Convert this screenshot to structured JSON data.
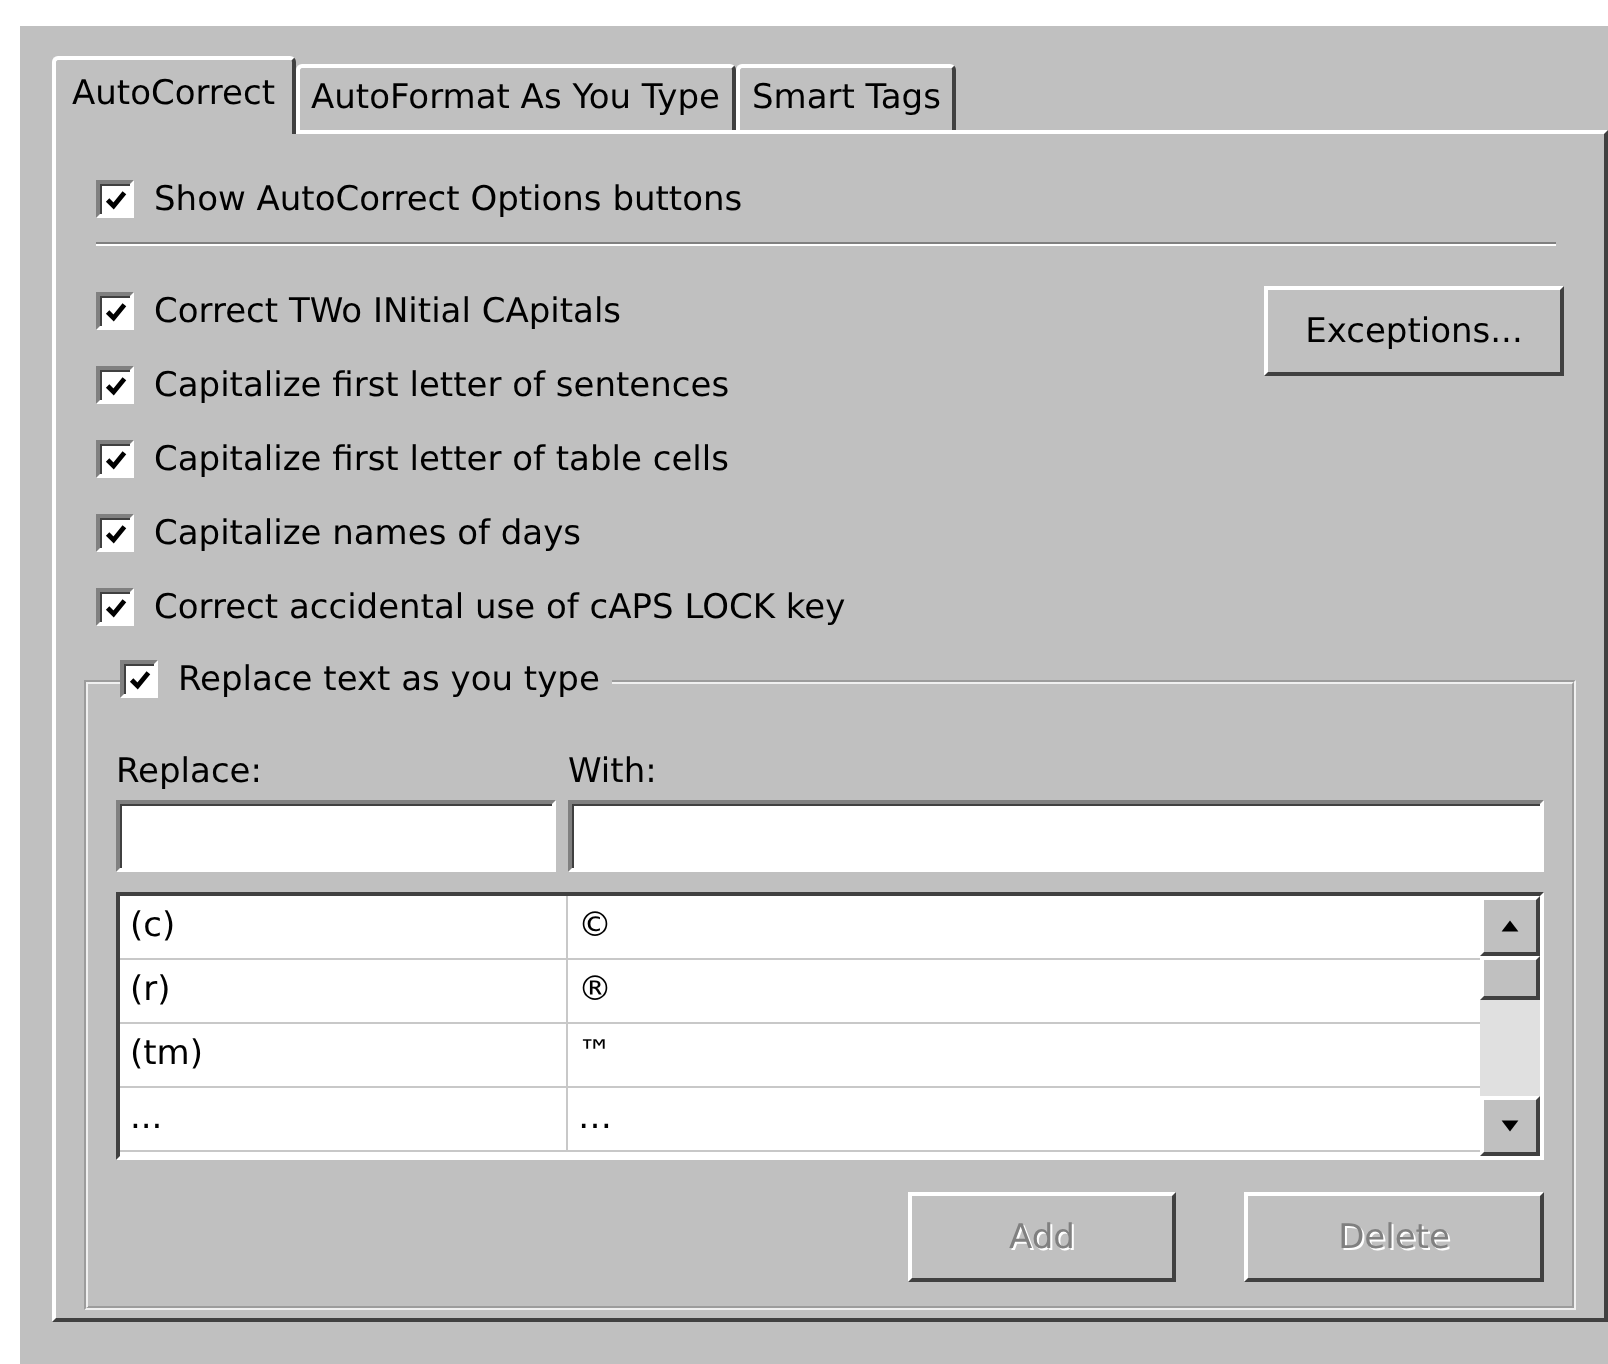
{
  "tabs": [
    {
      "label": "AutoCorrect",
      "selected": true
    },
    {
      "label": "AutoFormat As You Type",
      "selected": false
    },
    {
      "label": "Smart Tags",
      "selected": false
    }
  ],
  "show_options": {
    "label": "Show AutoCorrect Options buttons",
    "checked": true
  },
  "options": [
    {
      "label": "Correct TWo INitial CApitals",
      "checked": true
    },
    {
      "label": "Capitalize first letter of sentences",
      "checked": true
    },
    {
      "label": "Capitalize first letter of table cells",
      "checked": true
    },
    {
      "label": "Capitalize names of days",
      "checked": true
    },
    {
      "label": "Correct accidental use of cAPS LOCK key",
      "checked": true
    }
  ],
  "exceptions_button": "Exceptions...",
  "replace_group": {
    "label": "Replace text as you type",
    "checked": true,
    "replace_label": "Replace:",
    "with_label": "With:",
    "entries": [
      {
        "replace": "(c)",
        "with": "©"
      },
      {
        "replace": "(r)",
        "with": "®"
      },
      {
        "replace": "(tm)",
        "with": "™"
      },
      {
        "replace": "...",
        "with": "…"
      }
    ],
    "buttons": [
      {
        "label": "Add",
        "disabled": true
      },
      {
        "label": "Delete",
        "disabled": true
      }
    ]
  }
}
